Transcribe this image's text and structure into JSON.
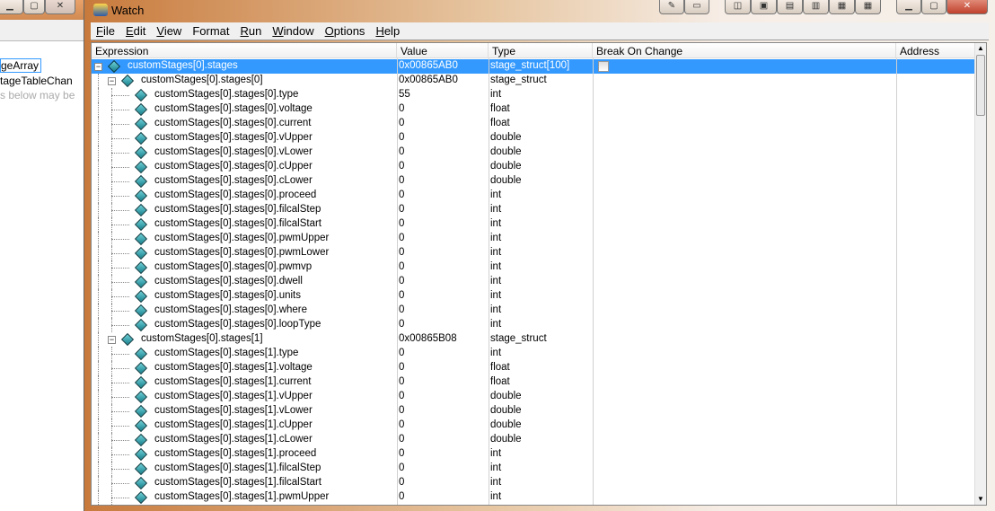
{
  "background_window": {
    "lines": [
      "geArray",
      "tageTableChan",
      "s below may be"
    ]
  },
  "window": {
    "title": "Watch",
    "app_icon": "cvi-icon"
  },
  "menu": [
    "File",
    "Edit",
    "View",
    "Format",
    "Run",
    "Window",
    "Options",
    "Help"
  ],
  "menu_mnemonic_index": [
    0,
    0,
    0,
    3,
    0,
    0,
    0,
    0
  ],
  "toolbar_icons": [
    "pin-icon",
    "float-window-icon",
    "dock-left-icon",
    "dock-center-icon",
    "dock-top-icon",
    "dock-bottom-icon",
    "tile-horizontal-icon",
    "tile-vertical-icon"
  ],
  "columns": [
    "Expression",
    "Value",
    "Type",
    "Break On Change",
    "Address"
  ],
  "rows": [
    {
      "level": 0,
      "expr": "customStages[0].stages",
      "value": "0x00865AB0",
      "type": "stage_struct[100]",
      "expanded": true,
      "selected": true,
      "checkbox": true
    },
    {
      "level": 1,
      "expr": "customStages[0].stages[0]",
      "value": "0x00865AB0",
      "type": "stage_struct",
      "expanded": true
    },
    {
      "level": 2,
      "expr": "customStages[0].stages[0].type",
      "value": "55",
      "type": "int"
    },
    {
      "level": 2,
      "expr": "customStages[0].stages[0].voltage",
      "value": "0",
      "type": "float"
    },
    {
      "level": 2,
      "expr": "customStages[0].stages[0].current",
      "value": "0",
      "type": "float"
    },
    {
      "level": 2,
      "expr": "customStages[0].stages[0].vUpper",
      "value": "0",
      "type": "double"
    },
    {
      "level": 2,
      "expr": "customStages[0].stages[0].vLower",
      "value": "0",
      "type": "double"
    },
    {
      "level": 2,
      "expr": "customStages[0].stages[0].cUpper",
      "value": "0",
      "type": "double"
    },
    {
      "level": 2,
      "expr": "customStages[0].stages[0].cLower",
      "value": "0",
      "type": "double"
    },
    {
      "level": 2,
      "expr": "customStages[0].stages[0].proceed",
      "value": "0",
      "type": "int"
    },
    {
      "level": 2,
      "expr": "customStages[0].stages[0].filcalStep",
      "value": "0",
      "type": "int"
    },
    {
      "level": 2,
      "expr": "customStages[0].stages[0].filcalStart",
      "value": "0",
      "type": "int"
    },
    {
      "level": 2,
      "expr": "customStages[0].stages[0].pwmUpper",
      "value": "0",
      "type": "int"
    },
    {
      "level": 2,
      "expr": "customStages[0].stages[0].pwmLower",
      "value": "0",
      "type": "int"
    },
    {
      "level": 2,
      "expr": "customStages[0].stages[0].pwmvp",
      "value": "0",
      "type": "int"
    },
    {
      "level": 2,
      "expr": "customStages[0].stages[0].dwell",
      "value": "0",
      "type": "int"
    },
    {
      "level": 2,
      "expr": "customStages[0].stages[0].units",
      "value": "0",
      "type": "int"
    },
    {
      "level": 2,
      "expr": "customStages[0].stages[0].where",
      "value": "0",
      "type": "int"
    },
    {
      "level": 2,
      "expr": "customStages[0].stages[0].loopType",
      "value": "0",
      "type": "int"
    },
    {
      "level": 1,
      "expr": "customStages[0].stages[1]",
      "value": "0x00865B08",
      "type": "stage_struct",
      "expanded": true
    },
    {
      "level": 2,
      "expr": "customStages[0].stages[1].type",
      "value": "0",
      "type": "int"
    },
    {
      "level": 2,
      "expr": "customStages[0].stages[1].voltage",
      "value": "0",
      "type": "float"
    },
    {
      "level": 2,
      "expr": "customStages[0].stages[1].current",
      "value": "0",
      "type": "float"
    },
    {
      "level": 2,
      "expr": "customStages[0].stages[1].vUpper",
      "value": "0",
      "type": "double"
    },
    {
      "level": 2,
      "expr": "customStages[0].stages[1].vLower",
      "value": "0",
      "type": "double"
    },
    {
      "level": 2,
      "expr": "customStages[0].stages[1].cUpper",
      "value": "0",
      "type": "double"
    },
    {
      "level": 2,
      "expr": "customStages[0].stages[1].cLower",
      "value": "0",
      "type": "double"
    },
    {
      "level": 2,
      "expr": "customStages[0].stages[1].proceed",
      "value": "0",
      "type": "int"
    },
    {
      "level": 2,
      "expr": "customStages[0].stages[1].filcalStep",
      "value": "0",
      "type": "int"
    },
    {
      "level": 2,
      "expr": "customStages[0].stages[1].filcalStart",
      "value": "0",
      "type": "int"
    },
    {
      "level": 2,
      "expr": "customStages[0].stages[1].pwmUpper",
      "value": "0",
      "type": "int"
    }
  ],
  "colors": {
    "selection": "#3399ff",
    "diamond": "#2aa0aa"
  }
}
